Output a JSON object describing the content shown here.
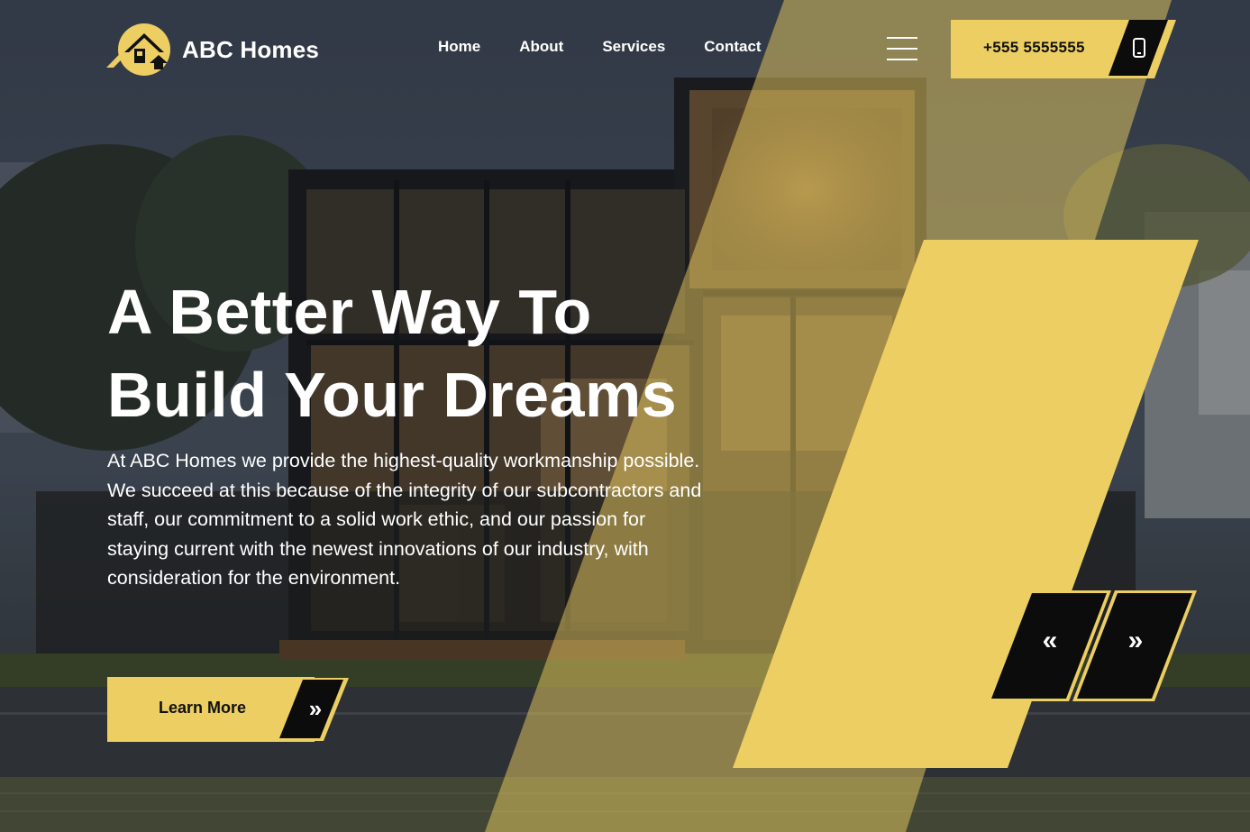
{
  "brand": {
    "name": "ABC Homes",
    "icon": "house-roof-icon"
  },
  "nav": {
    "items": [
      "Home",
      "About",
      "Services",
      "Contact"
    ]
  },
  "menu": {
    "icon": "hamburger-menu-icon"
  },
  "phone": {
    "number": "+555 5555555",
    "icon": "mobile-phone-icon"
  },
  "hero": {
    "headline_line1": "A Better Way To",
    "headline_line2": "Build Your Dreams",
    "description": "At ABC Homes we provide the highest-quality workmanship possible. We succeed at this because of the integrity of our subcontractors and staff, our commitment to a solid work ethic, and our passion for staying current with the newest innovations of our industry, with consideration for the environment.",
    "cta_label": "Learn More",
    "cta_arrow": "»"
  },
  "slider": {
    "prev_glyph": "«",
    "next_glyph": "»"
  },
  "colors": {
    "accent": "#ecce62",
    "dark": "#0c0c0c",
    "text": "#ffffff",
    "sky": "#3d4550"
  }
}
